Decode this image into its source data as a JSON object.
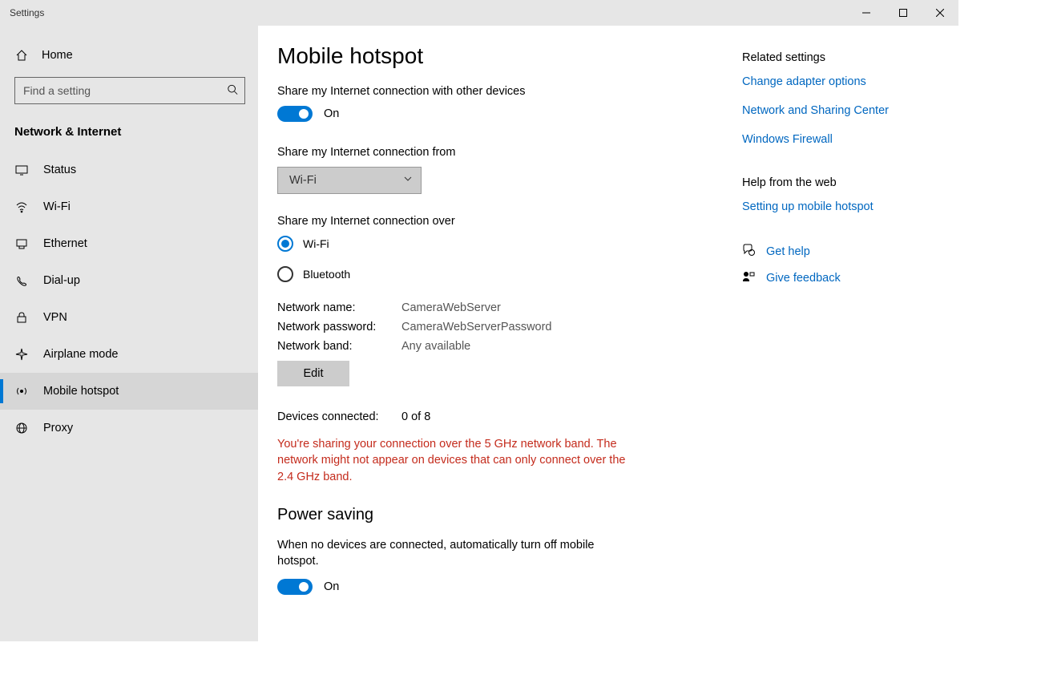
{
  "window": {
    "title": "Settings"
  },
  "sidebar": {
    "home_label": "Home",
    "search_placeholder": "Find a setting",
    "section_title": "Network & Internet",
    "items": [
      {
        "label": "Status"
      },
      {
        "label": "Wi-Fi"
      },
      {
        "label": "Ethernet"
      },
      {
        "label": "Dial-up"
      },
      {
        "label": "VPN"
      },
      {
        "label": "Airplane mode"
      },
      {
        "label": "Mobile hotspot"
      },
      {
        "label": "Proxy"
      }
    ]
  },
  "main": {
    "page_title": "Mobile hotspot",
    "share_label": "Share my Internet connection with other devices",
    "share_state": "On",
    "share_from_label": "Share my Internet connection from",
    "share_from_value": "Wi-Fi",
    "share_over_label": "Share my Internet connection over",
    "radio_wifi": "Wi-Fi",
    "radio_bt": "Bluetooth",
    "net_name_label": "Network name:",
    "net_name_value": "CameraWebServer",
    "net_pw_label": "Network password:",
    "net_pw_value": "CameraWebServerPassword",
    "net_band_label": "Network band:",
    "net_band_value": "Any available",
    "edit_btn": "Edit",
    "devices_label": "Devices connected:",
    "devices_value": "0 of 8",
    "warning": "You're sharing your connection over the 5 GHz network band. The network might not appear on devices that can only connect over the 2.4 GHz band.",
    "ps_heading": "Power saving",
    "ps_desc": "When no devices are connected, automatically turn off mobile hotspot.",
    "ps_state": "On"
  },
  "right": {
    "related_heading": "Related settings",
    "link_adapter": "Change adapter options",
    "link_nsc": "Network and Sharing Center",
    "link_firewall": "Windows Firewall",
    "help_heading": "Help from the web",
    "link_setting_up": "Setting up mobile hotspot",
    "link_get_help": "Get help",
    "link_feedback": "Give feedback"
  }
}
